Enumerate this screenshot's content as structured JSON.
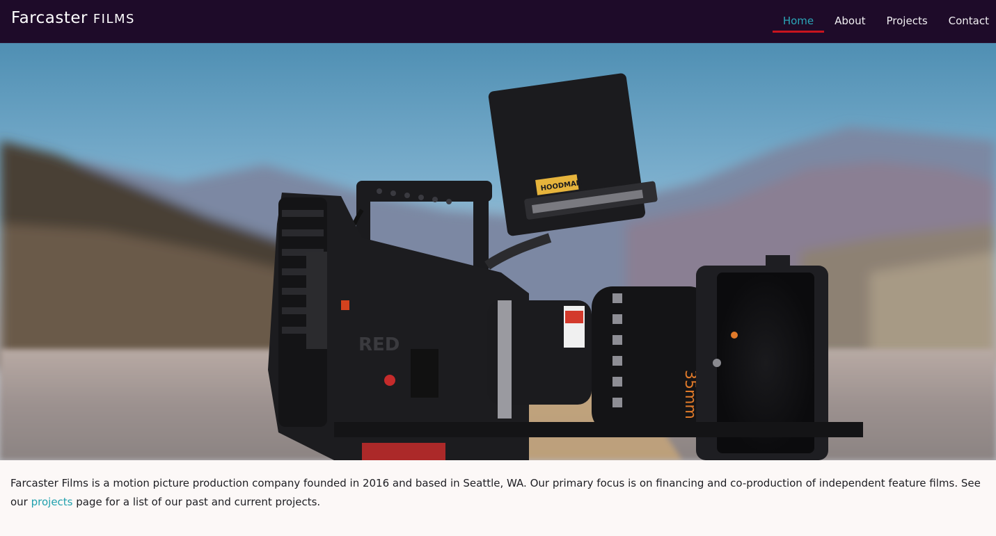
{
  "brand": {
    "name_first": "Farcaster",
    "name_second": "Films"
  },
  "nav": {
    "items": [
      {
        "label": "Home",
        "active": true
      },
      {
        "label": "About",
        "active": false
      },
      {
        "label": "Projects",
        "active": false
      },
      {
        "label": "Contact",
        "active": false
      }
    ]
  },
  "hero": {
    "image": "cinema-camera-on-road-photo",
    "camera_logo_text": "RED",
    "lens_text": "35mm",
    "tag_text": "HOODMAN"
  },
  "intro": {
    "text_before_link": "Farcaster Films is a motion picture production company founded in 2016 and based in Seattle, WA. Our primary focus is on financing and co-production of independent feature films. See our ",
    "link_text": "projects",
    "text_after_link": " page for a list of our past and current projects."
  },
  "colors": {
    "navbar_bg": "#1e0b29",
    "accent": "#2aa6b8",
    "active_underline": "#c8141e",
    "page_bg": "#fcf8f7"
  }
}
